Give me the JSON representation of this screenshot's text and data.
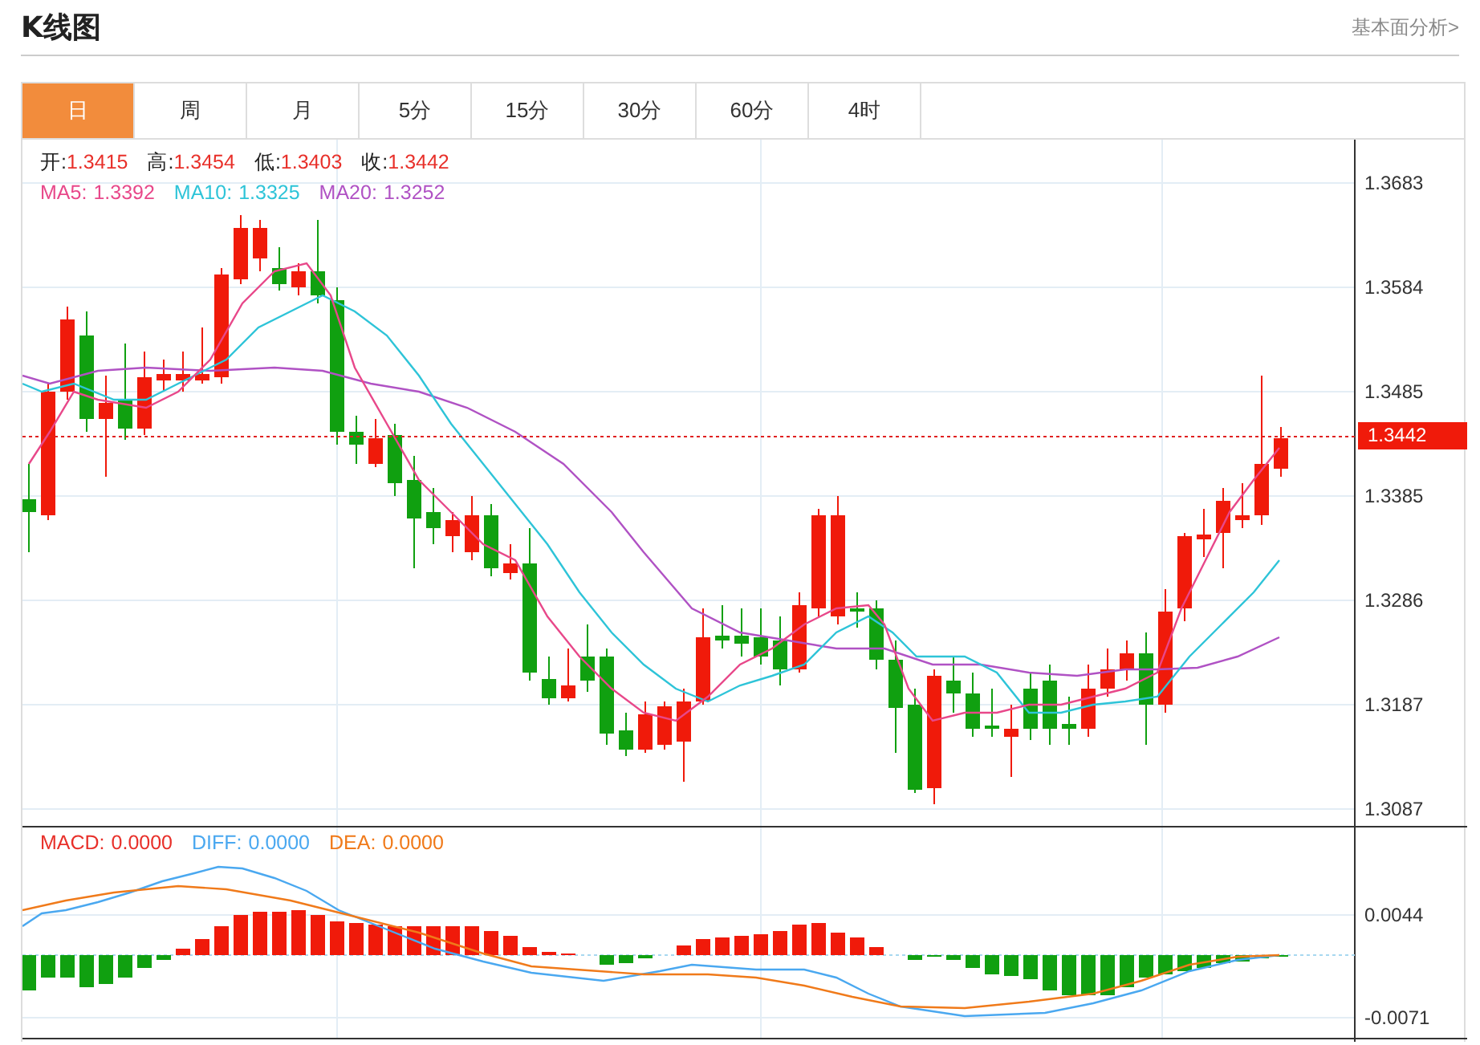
{
  "title": "K线图",
  "link": "基本面分析>",
  "tabs": [
    {
      "label": "日",
      "selected": true
    },
    {
      "label": "周",
      "selected": false
    },
    {
      "label": "月",
      "selected": false
    },
    {
      "label": "5分",
      "selected": false
    },
    {
      "label": "15分",
      "selected": false
    },
    {
      "label": "30分",
      "selected": false
    },
    {
      "label": "60分",
      "selected": false
    },
    {
      "label": "4时",
      "selected": false
    }
  ],
  "ohlc_legend": [
    {
      "label": "开:",
      "value": "1.3415"
    },
    {
      "label": "高:",
      "value": "1.3454"
    },
    {
      "label": "低:",
      "value": "1.3403"
    },
    {
      "label": "收:",
      "value": "1.3442"
    }
  ],
  "ma_legend": [
    {
      "label": "MA5:",
      "value": "1.3392",
      "color": "#e8488a"
    },
    {
      "label": "MA10:",
      "value": "1.3325",
      "color": "#2ec4d8"
    },
    {
      "label": "MA20:",
      "value": "1.3252",
      "color": "#b052c4"
    }
  ],
  "price_ticks": [
    "1.3683",
    "1.3584",
    "1.3485",
    "1.3385",
    "1.3286",
    "1.3187",
    "1.3087"
  ],
  "last_price": "1.3442",
  "macd_legend": [
    {
      "label": "MACD:",
      "value": "0.0000",
      "color": "#e8302a"
    },
    {
      "label": "DIFF:",
      "value": "0.0000",
      "color": "#4aa8f0"
    },
    {
      "label": "DEA:",
      "value": "0.0000",
      "color": "#f07a1a"
    }
  ],
  "macd_ticks": [
    "0.0044",
    "-0.0071"
  ]
}
